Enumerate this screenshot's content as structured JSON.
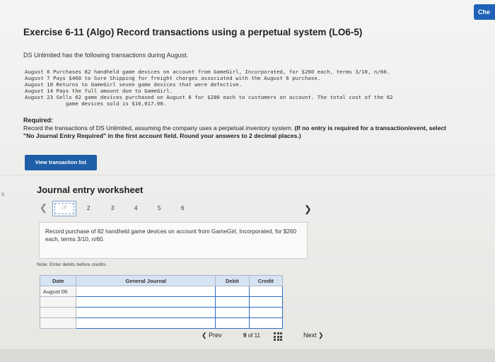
{
  "header": {
    "check_label": "Che"
  },
  "edge_mark": "s",
  "exercise": {
    "title": "Exercise 6-11 (Algo) Record transactions using a perpetual system (LO6-5)",
    "intro": "DS Unlimited has the following transactions during August.",
    "transactions": [
      "August 6 Purchases 82 handheld game devices on account from GameGirl, Incorporated, for $260 each, terms 3/10, n/60.",
      "August 7 Pays $460 to Sure Shipping for freight charges associated with the August 6 purchase.",
      "August 10 Returns to GameGirl seven game devices that were defective.",
      "August 14 Pays the full amount due to GameGirl.",
      "August 23 Sells 62 game devices purchased on August 6 for $280 each to customers on account. The total cost of the 62",
      "             game devices sold is $16,017.00."
    ],
    "required_label": "Required:",
    "required_text_plain": "Record the transactions of DS Unlimited, assuming the company uses a perpetual inventory system.",
    "required_text_bold": "(If no entry is required for a transaction/event, select \"No Journal Entry Required\" in the first account field. Round your answers to 2 decimal places.)"
  },
  "view_button": "View transaction list",
  "worksheet": {
    "title": "Journal entry worksheet",
    "nav_prev_icon": "chevron-left-icon",
    "nav_next_icon": "chevron-right-icon",
    "current_entry_icon": "hand-pointer-icon",
    "entry_numbers": [
      "2",
      "3",
      "4",
      "5",
      "6"
    ],
    "description": "Record purchase of 82 handheld game devices on account from GameGirl, Incorporated, for $260 each, terms 3/10, n/60.",
    "note": "Note: Enter debits before credits.",
    "table": {
      "headers": [
        "Date",
        "General Journal",
        "Debit",
        "Credit"
      ],
      "rows": [
        [
          "August 06",
          "",
          "",
          ""
        ],
        [
          "",
          "",
          "",
          ""
        ],
        [
          "",
          "",
          "",
          ""
        ],
        [
          "",
          "",
          "",
          ""
        ]
      ]
    }
  },
  "pager": {
    "prev": "Prev",
    "current": "9",
    "of": "of",
    "total": "11",
    "next": "Next"
  }
}
